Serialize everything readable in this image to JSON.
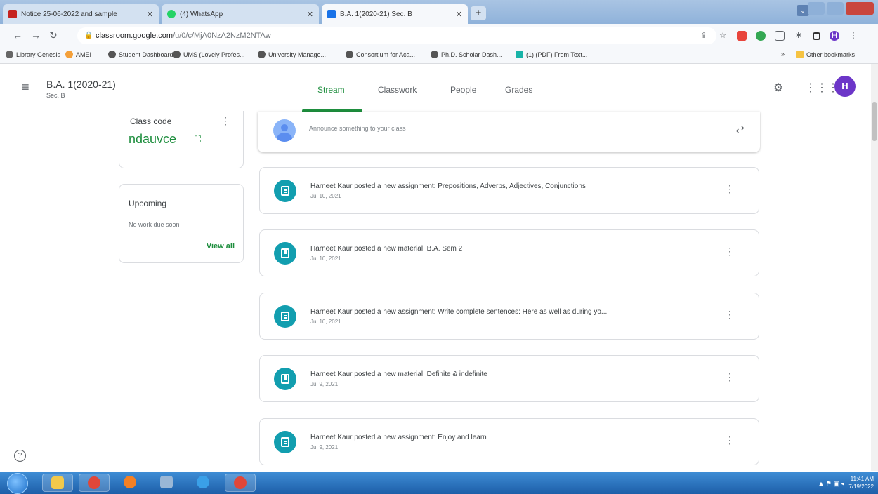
{
  "browser": {
    "tabs": [
      {
        "title": "Notice 25-06-2022 and sample"
      },
      {
        "title": "(4) WhatsApp"
      },
      {
        "title": "B.A. 1(2020-21) Sec. B"
      }
    ],
    "new_tab_label": "+",
    "profile_dropdown": "⌄",
    "url_host": "classroom.google.com",
    "url_path": "/u/0/c/MjA0NzA2NzM2NTAw",
    "bookmarks": [
      "Library Genesis",
      "AMEI",
      "Student Dashboard",
      "UMS (Lovely Profes...",
      "University Manage...",
      "Consortium for Aca...",
      "Ph.D. Scholar Dash...",
      "(1) (PDF) From Text..."
    ],
    "bookmarks_overflow": "»",
    "other_bookmarks": "Other bookmarks"
  },
  "classroom": {
    "class_title": "B.A. 1(2020-21)",
    "class_section": "Sec. B",
    "nav": [
      "Stream",
      "Classwork",
      "People",
      "Grades"
    ],
    "avatar_initial": "H"
  },
  "class_code": {
    "label": "Class code",
    "code": "ndauvce"
  },
  "upcoming": {
    "title": "Upcoming",
    "empty": "No work due soon",
    "view_all": "View all"
  },
  "announce": {
    "placeholder": "Announce something to your class"
  },
  "posts": [
    {
      "type": "assignment",
      "title": "Harneet Kaur posted a new assignment: Prepositions, Adverbs, Adjectives, Conjunctions",
      "date": "Jul 10, 2021"
    },
    {
      "type": "material",
      "title": "Harneet Kaur posted a new material: B.A. Sem 2",
      "date": "Jul 10, 2021"
    },
    {
      "type": "assignment",
      "title": "Harneet Kaur posted a new assignment: Write complete sentences: Here as well as during yo...",
      "date": "Jul 10, 2021"
    },
    {
      "type": "material",
      "title": "Harneet Kaur posted a new material: Definite & indefinite",
      "date": "Jul 9, 2021"
    },
    {
      "type": "assignment",
      "title": "Harneet Kaur posted a new assignment: Enjoy and learn",
      "date": "Jul 9, 2021"
    }
  ],
  "taskbar": {
    "time": "11:41 AM",
    "date": "7/19/2022"
  },
  "colors": {
    "accent_green": "#1e8e3e",
    "post_icon_teal": "#129eaf",
    "avatar_purple": "#6c36c8"
  }
}
